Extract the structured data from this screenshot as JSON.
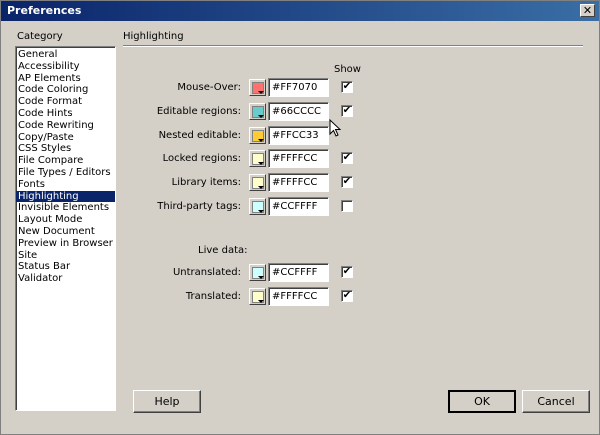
{
  "window": {
    "title": "Preferences",
    "close_glyph": "✕"
  },
  "category": {
    "label": "Category",
    "items": [
      "General",
      "Accessibility",
      "AP Elements",
      "Code Coloring",
      "Code Format",
      "Code Hints",
      "Code Rewriting",
      "Copy/Paste",
      "CSS Styles",
      "File Compare",
      "File Types / Editors",
      "Fonts",
      "Highlighting",
      "Invisible Elements",
      "Layout Mode",
      "New Document",
      "Preview in Browser",
      "Site",
      "Status Bar",
      "Validator"
    ],
    "selected": "Highlighting"
  },
  "highlighting": {
    "title": "Highlighting",
    "show_label": "Show",
    "rows": [
      {
        "label": "Mouse-Over:",
        "hex": "#FF7070",
        "color": "#ff7070",
        "checked": true
      },
      {
        "label": "Editable regions:",
        "hex": "#66CCCC",
        "color": "#66cccc",
        "checked": true
      },
      {
        "label": "Nested editable:",
        "hex": "#FFCC33",
        "color": "#ffcc33",
        "checked": null
      },
      {
        "label": "Locked regions:",
        "hex": "#FFFFCC",
        "color": "#ffffcc",
        "checked": true
      },
      {
        "label": "Library items:",
        "hex": "#FFFFCC",
        "color": "#ffffcc",
        "checked": true
      },
      {
        "label": "Third-party tags:",
        "hex": "#CCFFFF",
        "color": "#ccffff",
        "checked": false
      }
    ],
    "live_data_label": "Live data:",
    "live_rows": [
      {
        "label": "Untranslated:",
        "hex": "#CCFFFF",
        "color": "#ccffff",
        "checked": true
      },
      {
        "label": "Translated:",
        "hex": "#FFFFCC",
        "color": "#ffffcc",
        "checked": true
      }
    ]
  },
  "buttons": {
    "help": "Help",
    "ok": "OK",
    "cancel": "Cancel"
  },
  "check_glyph": "✔"
}
